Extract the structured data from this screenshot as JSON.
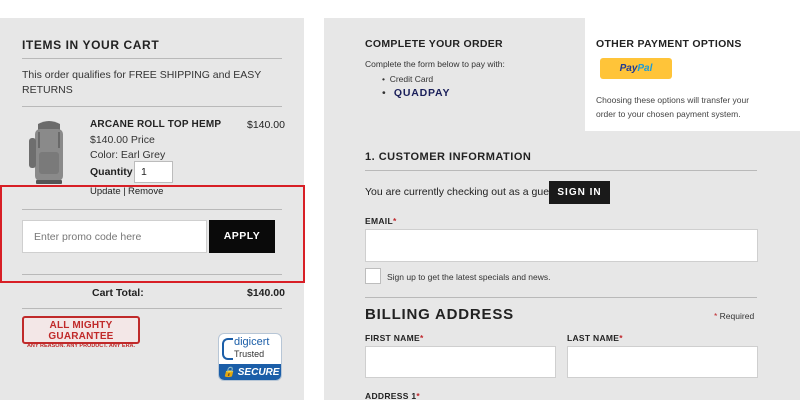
{
  "cart": {
    "title": "ITEMS IN YOUR CART",
    "shipping_note": "This order qualifies for FREE SHIPPING and EASY RETURNS",
    "product": {
      "name": "ARCANE ROLL TOP HEMP",
      "price": "$140.00",
      "price_line": "$140.00 Price",
      "color_line": "Color: Earl Grey",
      "quantity_label": "Quantity",
      "quantity_value": "1",
      "update_label": "Update |",
      "remove_label": "Remove"
    },
    "promo_placeholder": "Enter promo code here",
    "apply_label": "APPLY",
    "total_label": "Cart Total:",
    "total_value": "$140.00"
  },
  "badges": {
    "guarantee_title": "ALL MIGHTY GUARANTEE",
    "guarantee_sub": "ANY REASON. ANY PRODUCT. ANY ERA.",
    "digicert_name": "digicert",
    "digicert_trusted": "Trusted",
    "digicert_secure": "SECURE"
  },
  "checkout": {
    "title": "COMPLETE YOUR ORDER",
    "instructions": "Complete the form below to pay with:",
    "methods": [
      "Credit Card",
      "QUADPAY"
    ]
  },
  "other_payment": {
    "title": "OTHER PAYMENT OPTIONS",
    "paypal_a": "Pay",
    "paypal_b": "Pal",
    "note": "Choosing these options will transfer your order to your chosen payment system."
  },
  "customer": {
    "section_title": "1. CUSTOMER INFORMATION",
    "guest_text": "You are currently checking out as a guest.",
    "signin_label": "SIGN IN",
    "email_label": "EMAIL",
    "email_value": "",
    "signup_text": "Sign up to get the latest specials and news."
  },
  "billing": {
    "title": "BILLING ADDRESS",
    "required_text": "Required",
    "first_name_label": "FIRST NAME",
    "last_name_label": "LAST NAME",
    "address1_label": "ADDRESS 1"
  },
  "colors": {
    "panel_bg": "#e7e7e7",
    "button_bg": "#0a0a0a",
    "highlight": "#d81f26",
    "paypal_yellow": "#ffc439",
    "required_red": "#c0282d"
  }
}
